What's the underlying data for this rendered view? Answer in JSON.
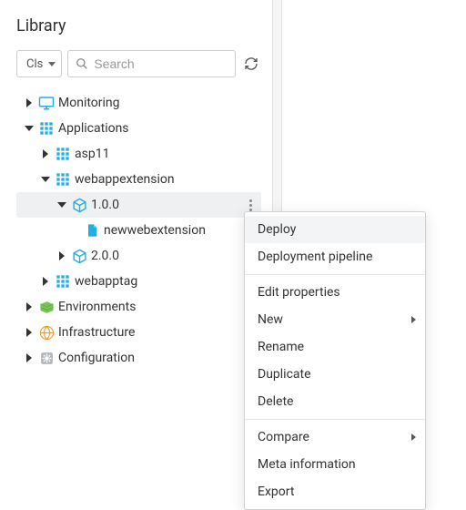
{
  "title": "Library",
  "filter": {
    "label": "Cls"
  },
  "search": {
    "placeholder": "Search",
    "value": ""
  },
  "tree": {
    "monitoring": "Monitoring",
    "applications": "Applications",
    "asp11": "asp11",
    "webappextension": "webappextension",
    "v100": "1.0.0",
    "newwebextension": "newwebextension",
    "v200": "2.0.0",
    "webapptag": "webapptag",
    "environments": "Environments",
    "infrastructure": "Infrastructure",
    "configuration": "Configuration"
  },
  "menu": {
    "deploy": "Deploy",
    "deployment_pipeline": "Deployment pipeline",
    "edit_properties": "Edit properties",
    "new": "New",
    "rename": "Rename",
    "duplicate": "Duplicate",
    "delete": "Delete",
    "compare": "Compare",
    "meta_information": "Meta information",
    "export": "Export"
  },
  "colors": {
    "accent": "#21aee4",
    "env": "#78c355",
    "infra": "#f29b2e",
    "config": "#b0b6bc"
  }
}
